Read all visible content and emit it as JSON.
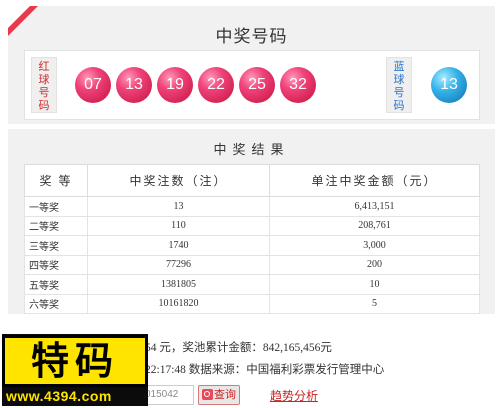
{
  "header": {
    "title": "中奖号码"
  },
  "red_label": "红球号码",
  "blue_label": "蓝球号码",
  "red_balls": [
    "07",
    "13",
    "19",
    "22",
    "25",
    "32"
  ],
  "blue_ball": "13",
  "results": {
    "title": "中奖结果",
    "columns": [
      "奖 等",
      "中奖注数（注）",
      "单注中奖金额（元）"
    ],
    "rows": [
      {
        "level": "一等奖",
        "count": "13",
        "amount": "6,413,151"
      },
      {
        "level": "二等奖",
        "count": "110",
        "amount": "208,761"
      },
      {
        "level": "三等奖",
        "count": "1740",
        "amount": "3,000"
      },
      {
        "level": "四等奖",
        "count": "77296",
        "amount": "200"
      },
      {
        "level": "五等奖",
        "count": "1381805",
        "amount": "10"
      },
      {
        "level": "六等奖",
        "count": "10161820",
        "amount": "5"
      }
    ]
  },
  "info": {
    "line1": "54 元，奖池累计金额：842,165,456元",
    "line2": "22:17:48  数据来源：中国福利彩票发行管理中心"
  },
  "query": {
    "input_value": "015042",
    "button_label": "查询"
  },
  "trend_link": "趋势分析",
  "watermark": {
    "big_text": "特码",
    "url": "www.4394.com"
  },
  "colors": {
    "accent": "#e83a4a",
    "red_ball": "#e0245e",
    "blue_ball": "#1f8fd6",
    "watermark_yellow": "#ffe400"
  }
}
